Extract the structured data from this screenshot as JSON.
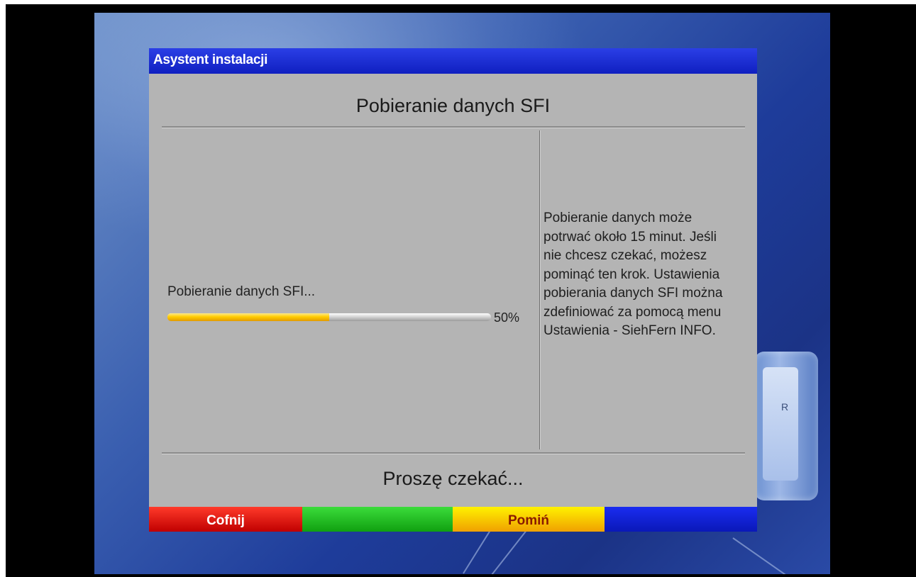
{
  "dialog": {
    "title": "Asystent instalacji",
    "heading": "Pobieranie danych SFI"
  },
  "progress": {
    "label": "Pobieranie danych SFI...",
    "percent_text": "50%",
    "value": 50
  },
  "info": {
    "lines": [
      "Pobieranie danych może",
      "potrwać około 15 minut. Jeśli",
      "nie chcesz czekać, możesz",
      "pominąć ten krok. Ustawienia",
      "pobierania danych SFI można",
      "zdefiniować za pomocą menu",
      "Ustawienia - SiehFern INFO."
    ]
  },
  "status": {
    "wait_text": "Proszę czekać..."
  },
  "buttons": {
    "red_label": "Cofnij",
    "green_label": "",
    "yellow_label": "Pomiń",
    "blue_label": ""
  },
  "decor": {
    "plug_letter": "R"
  },
  "colors": {
    "red": "#d41010",
    "green": "#1fbf1f",
    "yellow": "#ffd000",
    "blue": "#0a1ad8",
    "progress_fill": "#ffcc00"
  }
}
